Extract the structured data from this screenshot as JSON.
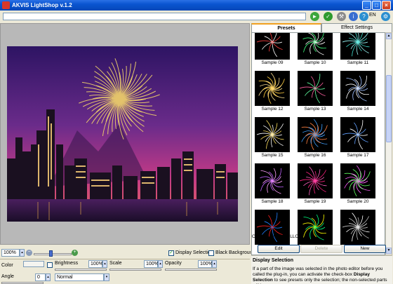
{
  "window": {
    "title": "AKVIS LightShop v.1.2"
  },
  "toolbar": {
    "path_value": "",
    "language": "EN"
  },
  "zoom": {
    "value": "100%"
  },
  "options": {
    "display_selection_label": "Display Selection",
    "display_selection_checked": true,
    "black_background_label": "Black Background",
    "black_background_checked": false
  },
  "settings": {
    "color_label": "Color",
    "brightness_label": "Brightness",
    "brightness_value": "100%",
    "scale_label": "Scale",
    "scale_value": "100%",
    "opacity_label": "Opacity",
    "opacity_value": "100%",
    "angle_label": "Angle",
    "angle_value": "0",
    "blend_mode": "Normal"
  },
  "tabs": [
    {
      "label": "Presets",
      "active": true
    },
    {
      "label": "Effect Settings",
      "active": false
    }
  ],
  "presets": [
    {
      "label": "Sample 09",
      "style": "ring-red"
    },
    {
      "label": "Sample 10",
      "style": "burst-green"
    },
    {
      "label": "Sample 11",
      "style": "spray-teal"
    },
    {
      "label": "Sample 12",
      "style": "swirl-gold"
    },
    {
      "label": "Sample 13",
      "style": "swirl-rainbow"
    },
    {
      "label": "Sample 14",
      "style": "swirl-white"
    },
    {
      "label": "Sample 15",
      "style": "star-gold"
    },
    {
      "label": "Sample 16",
      "style": "spiral-rainbow"
    },
    {
      "label": "Sample 17",
      "style": "spiral-blue"
    },
    {
      "label": "Sample 18",
      "style": "streak-violet"
    },
    {
      "label": "Sample 19",
      "style": "flower-pink"
    },
    {
      "label": "Sample 20",
      "style": "atom-green"
    },
    {
      "label": "",
      "style": "flower-spectrum"
    },
    {
      "label": "",
      "style": "diamond-spectrum"
    },
    {
      "label": "",
      "style": "wisp-white"
    }
  ],
  "panel": {
    "credit": "Created by AKVIS LLC.",
    "edit_label": "Edit",
    "delete_label": "Delete",
    "new_label": "New"
  },
  "help": {
    "title": "Display Selection",
    "text_1": "If a part of the image was selected in the photo editor before you called the plug-in, you can activate the check-box ",
    "text_bold": "Display Selection",
    "text_2": " to see presets only the selection; the non-selected parts will be"
  },
  "colors": {
    "accent": "#0a55d0",
    "sky_top": "#3b1a6b",
    "sky_bottom": "#c0307a",
    "firework": "#f3d56a"
  }
}
